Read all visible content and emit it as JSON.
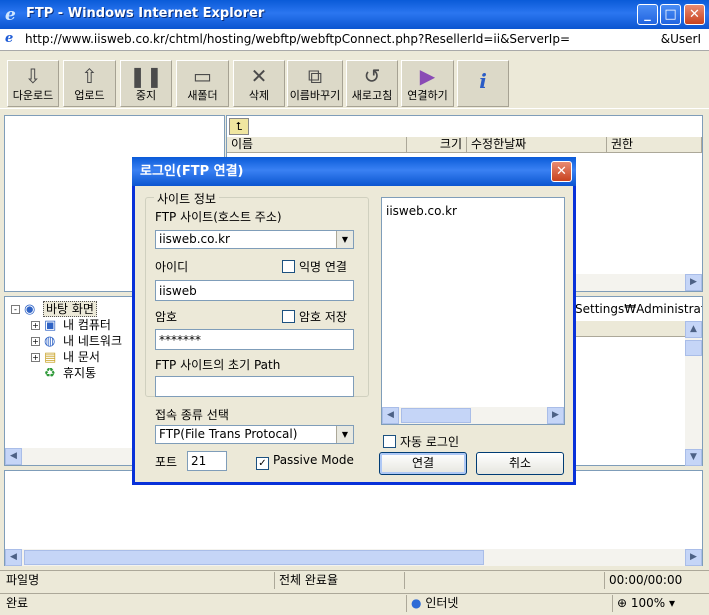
{
  "window": {
    "title": "FTP - Windows Internet Explorer",
    "minimize": "_",
    "maximize": "□",
    "close": "✕"
  },
  "address": {
    "url": "http://www.iisweb.co.kr/chtml/hosting/webftp/webftpConnect.php?ResellerId=ii&ServerIp=",
    "url_tail": "&UserI"
  },
  "toolbar": [
    {
      "label": "다운로드",
      "icon": "download-icon",
      "glyph": "⇩"
    },
    {
      "label": "업로드",
      "icon": "upload-icon",
      "glyph": "⇧"
    },
    {
      "label": "중지",
      "icon": "pause-icon",
      "glyph": "❚❚"
    },
    {
      "label": "새폴더",
      "icon": "new-folder-icon",
      "glyph": "▭"
    },
    {
      "label": "삭제",
      "icon": "delete-icon",
      "glyph": "✕"
    },
    {
      "label": "이름바꾸기",
      "icon": "rename-icon",
      "glyph": "⧉"
    },
    {
      "label": "새로고침",
      "icon": "refresh-icon",
      "glyph": "↺"
    },
    {
      "label": "연결하기",
      "icon": "connect-icon",
      "glyph": "▶"
    }
  ],
  "info_glyph": "i",
  "remote": {
    "folder_up_glyph": "⮤",
    "columns": [
      "이름",
      "크기",
      "수정한날짜",
      "권한"
    ]
  },
  "local": {
    "path_fragment": "Settings₩Administrato",
    "tree": [
      {
        "label": "바탕 화면",
        "expander": "-",
        "icon": "desktop-icon",
        "glyph": "◉"
      },
      {
        "label": "내 컴퓨터",
        "expander": "+",
        "icon": "computer-icon",
        "glyph": "▣"
      },
      {
        "label": "내 네트워크",
        "expander": "+",
        "icon": "network-icon",
        "glyph": "◍"
      },
      {
        "label": "내 문서",
        "expander": "+",
        "icon": "documents-icon",
        "glyph": "▤"
      },
      {
        "label": "휴지통",
        "expander": "",
        "icon": "recycle-bin-icon",
        "glyph": "♻"
      }
    ]
  },
  "transfer_status": {
    "filename_label": "파일명",
    "total_label": "전체 완료율",
    "time": "00:00/00:00"
  },
  "statusbar": {
    "done": "완료",
    "zone": "인터넷",
    "zoom": "100%",
    "zoom_arrow": "▾"
  },
  "dialog": {
    "title": "로그인(FTP 연결)",
    "close": "✕",
    "group_title": "사이트 정보",
    "site_label": "FTP 사이트(호스트 주소)",
    "site_value": "iisweb.co.kr",
    "id_label": "아이디",
    "anonymous_label": "익명 연결",
    "id_value": "iisweb",
    "password_label": "암호",
    "save_password_label": "암호 저장",
    "password_value": "*******",
    "path_label": "FTP 사이트의 초기 Path",
    "path_value": "",
    "connection_type_label": "접속 종류 선택",
    "connection_type_value": "FTP(File Trans Protocal)",
    "port_label": "포트",
    "port_value": "21",
    "passive_label": "Passive Mode",
    "passive_checked": "✓",
    "site_list": [
      "iisweb.co.kr"
    ],
    "auto_login_label": "자동 로그인",
    "connect_button": "연결",
    "cancel_button": "취소",
    "arrow_down": "▼"
  }
}
